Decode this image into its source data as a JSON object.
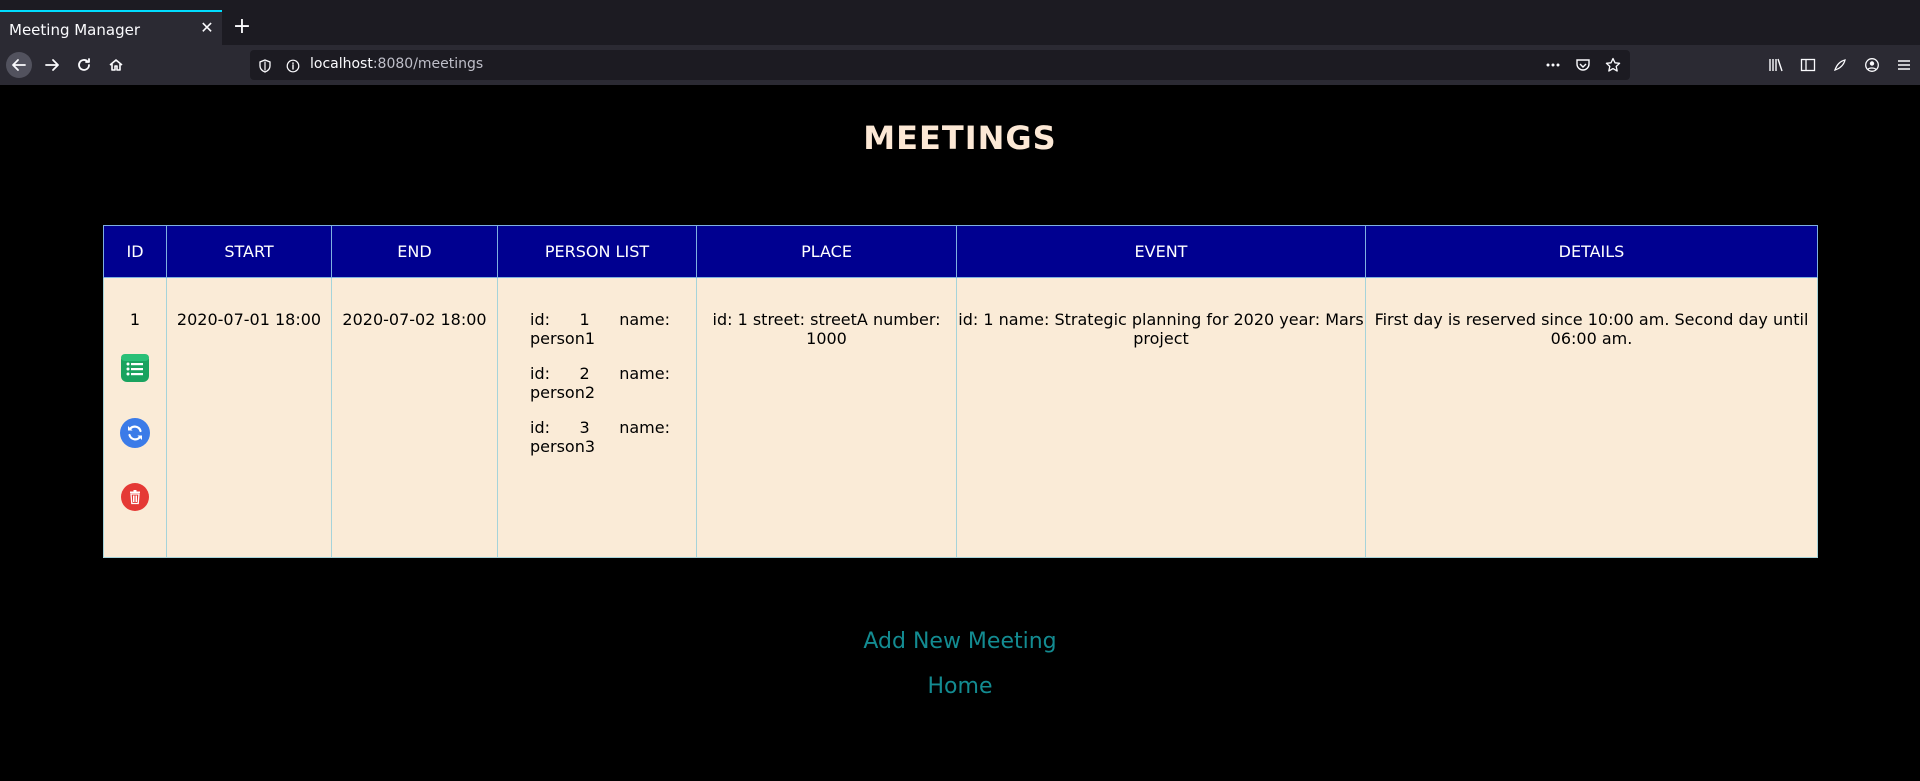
{
  "browser": {
    "tab_title": "Meeting Manager",
    "url_host": "localhost",
    "url_rest": ":8080/meetings"
  },
  "page": {
    "title": "MEETINGS"
  },
  "table": {
    "headers": [
      "ID",
      "START",
      "END",
      "PERSON LIST",
      "PLACE",
      "EVENT",
      "DETAILS"
    ],
    "rows": [
      {
        "id": "1",
        "start": "2020-07-01 18:00",
        "end": "2020-07-02 18:00",
        "persons": [
          "id: 1 name: person1",
          "id: 2 name: person2",
          "id: 3 name: person3"
        ],
        "place": "id: 1 street: streetA number: 1000",
        "event": "id: 1 name: Strategic planning for 2020 year: Mars project",
        "details": "First day is reserved since 10:00 am. Second day until 06:00 am."
      }
    ]
  },
  "links": {
    "add_new": "Add New Meeting",
    "home": "Home"
  },
  "colors": {
    "header_bg": "#000090",
    "cell_bg": "#faebd7",
    "title": "#fce8d5",
    "link": "#138b91",
    "update_icon": "#3b7be8",
    "delete_icon": "#e53935",
    "details_icon": "#1aa35f"
  },
  "icons": {
    "details": "list-icon",
    "update": "refresh-icon",
    "delete": "trash-icon"
  }
}
